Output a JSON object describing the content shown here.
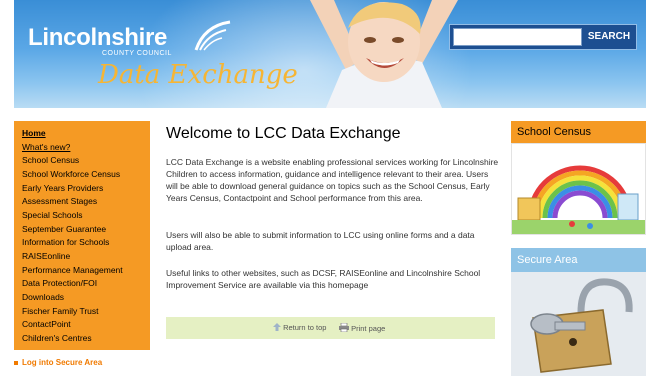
{
  "header": {
    "logo_main": "Lincolnshire",
    "logo_sub": "COUNTY COUNCIL",
    "logo_tagline": "Data Exchange",
    "search": {
      "placeholder": "",
      "value": "",
      "button_label": "SEARCH"
    }
  },
  "leftnav": {
    "items": [
      {
        "label": "Home",
        "state": "active"
      },
      {
        "label": "What's new?",
        "state": "underlined"
      },
      {
        "label": "School Census"
      },
      {
        "label": "School Workforce Census"
      },
      {
        "label": "Early Years Providers"
      },
      {
        "label": "Assessment Stages"
      },
      {
        "label": "Special Schools"
      },
      {
        "label": "September Guarantee"
      },
      {
        "label": "Information for Schools"
      },
      {
        "label": "RAISEonline"
      },
      {
        "label": "Performance Management"
      },
      {
        "label": "Data Protection/FOI"
      },
      {
        "label": "Downloads"
      },
      {
        "label": "Fischer Family Trust"
      },
      {
        "label": "ContactPoint"
      },
      {
        "label": "Children's Centres"
      }
    ],
    "login_link": "Log into Secure Area"
  },
  "main": {
    "title": "Welcome to LCC Data Exchange",
    "paragraphs": [
      "LCC Data Exchange is a website enabling professional services working for Lincolnshire Children to access information, guidance and intelligence relevant to their area. Users will be able to download general guidance on topics such as the School Census, Early Years Census, Contactpoint and School performance from this area.",
      "Users will also be able to submit information to LCC using online forms and a data upload area.",
      "Useful links to other websites, such as DCSF, RAISEonline and Lincolnshire School Improvement Service are available via this homepage"
    ],
    "footer": {
      "return_to_top": "Return to top",
      "print_page": "Print page"
    }
  },
  "right": {
    "census_title": "School Census",
    "secure_title": "Secure Area"
  },
  "colors": {
    "nav_orange": "#f59a24",
    "banner_blue": "#3a8ed6",
    "search_navy": "#1d4f91",
    "footer_green": "#e5f0c3",
    "secure_blue": "#8ec3e6"
  }
}
